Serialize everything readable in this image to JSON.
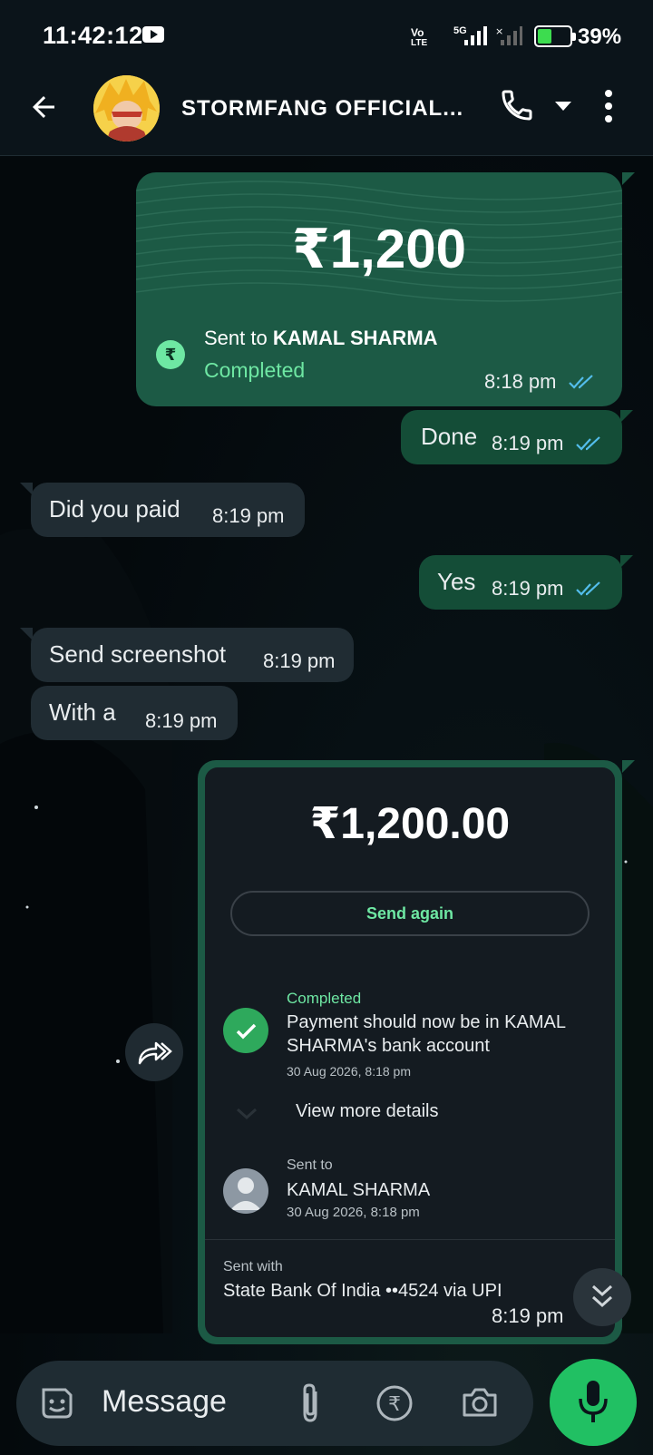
{
  "status_bar": {
    "time": "11:42:12",
    "volte": "Vo",
    "volte2": "LTE",
    "net": "5G",
    "battery": "39%",
    "battery_level": 0.39
  },
  "header": {
    "title": "STORMFANG OFFICIAL...",
    "back_icon": "arrow-left-icon",
    "call_icon": "phone-icon",
    "menu_icon": "more-vert-icon"
  },
  "messages": {
    "payment": {
      "amount": "₹1,200",
      "sent_to_prefix": "Sent to ",
      "recipient": "KAMAL SHARMA",
      "status": "Completed",
      "time": "8:18 pm",
      "rupee_symbol": "₹"
    },
    "m1": {
      "text": "Done",
      "time": "8:19 pm"
    },
    "m2": {
      "text": "Did you paid",
      "time": "8:19 pm"
    },
    "m3": {
      "text": "Yes",
      "time": "8:19 pm"
    },
    "m4": {
      "text": "Send screenshot",
      "time": "8:19 pm"
    },
    "m5": {
      "text": "With a",
      "time": "8:19 pm"
    },
    "screenshot": {
      "amount": "₹1,200.00",
      "send_again": "Send again",
      "status": "Completed",
      "status_line1": "Payment should now be in KAMAL",
      "status_line2": "SHARMA's bank account",
      "status_date": "30 Aug 2026, 8:18 pm",
      "view_more": "View more details",
      "sent_to_label": "Sent to",
      "sent_to_name": "KAMAL SHARMA",
      "sent_to_date": "30 Aug 2026, 8:18 pm",
      "sent_with_label": "Sent with",
      "sent_with_value": "State Bank Of India ••4524 via UPI",
      "time": "8:19 pm"
    }
  },
  "input": {
    "placeholder": "Message",
    "icons": [
      "sticker-icon",
      "attach-icon",
      "rupee-icon",
      "camera-icon",
      "mic-icon"
    ]
  },
  "colors": {
    "accent": "#21c063",
    "outgoing": "#144d37",
    "incoming": "#202c33",
    "tick": "#53bdeb"
  }
}
